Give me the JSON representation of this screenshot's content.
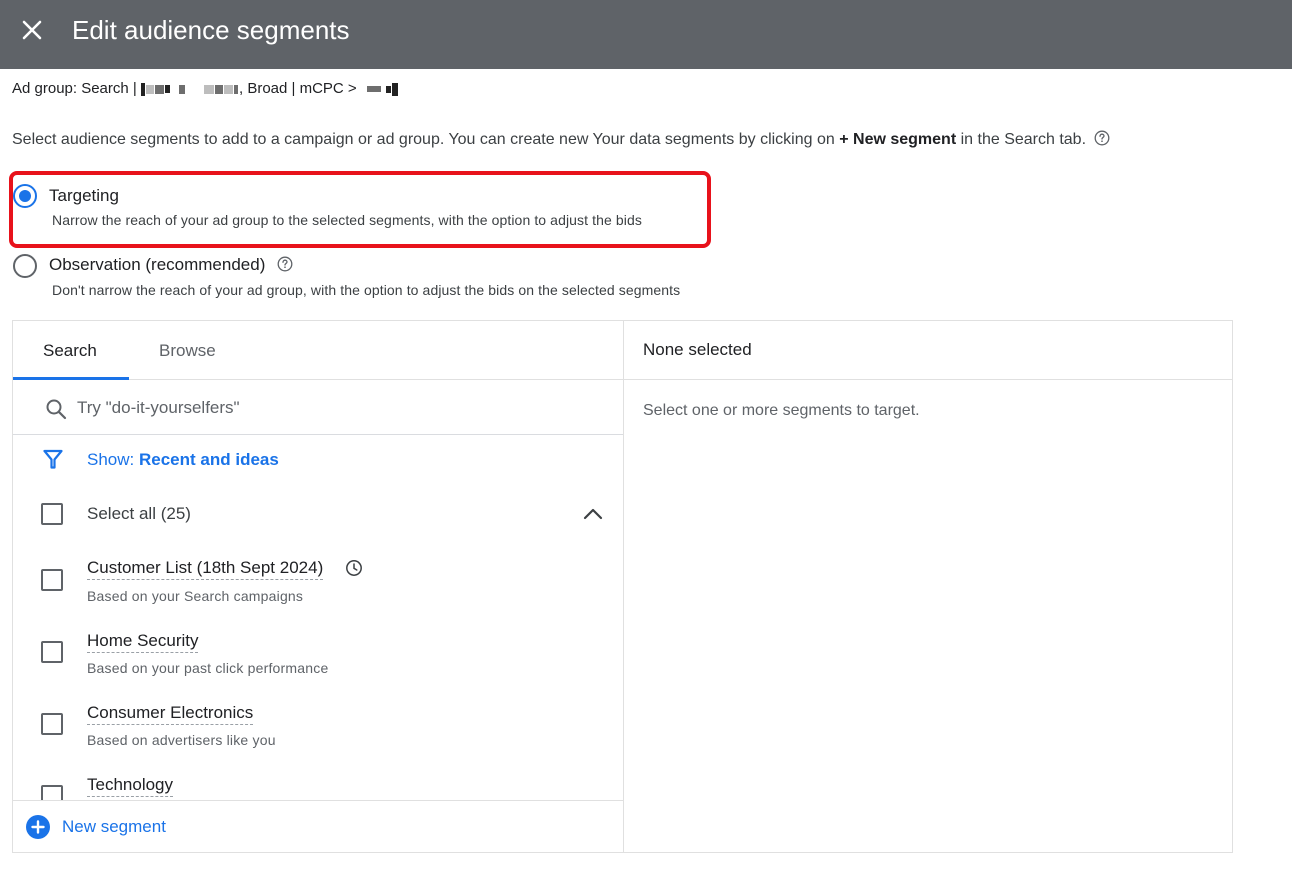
{
  "header": {
    "title": "Edit audience segments",
    "close_icon": "close-icon"
  },
  "ad_group": {
    "prefix": "Ad group: Search | ",
    "middle": ", Broad | mCPC > "
  },
  "intro": {
    "text_before": "Select audience segments to add to a campaign or ad group. You can create new Your data segments by clicking on ",
    "bold": "+ New segment",
    "text_after": " in the Search tab."
  },
  "options": {
    "targeting": {
      "label": "Targeting",
      "description": "Narrow the reach of your ad group to the selected segments, with the option to adjust the bids",
      "selected": true
    },
    "observation": {
      "label": "Observation (recommended)",
      "description": "Don't narrow the reach of your ad group, with the option to adjust the bids on the selected segments",
      "selected": false
    }
  },
  "tabs": [
    {
      "label": "Search",
      "active": true
    },
    {
      "label": "Browse",
      "active": false
    }
  ],
  "search": {
    "placeholder": "Try \"do-it-yourselfers\""
  },
  "filter": {
    "prefix": "Show: ",
    "value": "Recent and ideas"
  },
  "select_all": {
    "label": "Select all (25)"
  },
  "segments": [
    {
      "name": "Customer List (18th Sept 2024)",
      "sub": "Based on your Search campaigns",
      "recent": true
    },
    {
      "name": "Home Security",
      "sub": "Based on your past click performance"
    },
    {
      "name": "Consumer Electronics",
      "sub": "Based on advertisers like you"
    },
    {
      "name": "Technology",
      "sub": ""
    }
  ],
  "new_segment": {
    "label": "New segment"
  },
  "selected_panel": {
    "header": "None selected",
    "empty_text": "Select one or more segments to target."
  },
  "colors": {
    "header_bg": "#5f6368",
    "accent": "#1a73e8",
    "highlight": "#e8121b"
  }
}
